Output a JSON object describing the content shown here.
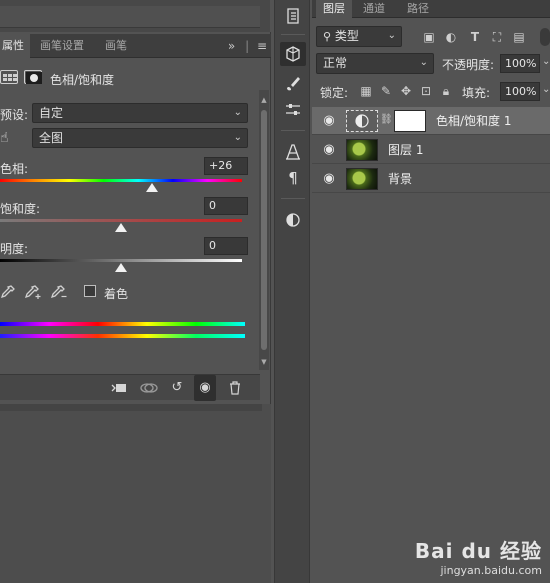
{
  "properties_panel": {
    "tabs": [
      {
        "label": "属性",
        "active": true
      },
      {
        "label": "画笔设置",
        "active": false
      },
      {
        "label": "画笔",
        "active": false
      }
    ],
    "menu_icon": "»",
    "adjustment_title": "色相/饱和度",
    "preset_label": "预设:",
    "preset_value": "自定",
    "channel_value": "全图",
    "hue_label": "色相:",
    "hue_value": "+26",
    "saturation_label": "饱和度:",
    "saturation_value": "0",
    "lightness_label": "明度:",
    "lightness_value": "0",
    "colorize_label": "着色"
  },
  "layers_panel": {
    "tabs": [
      {
        "label": "图层",
        "active": true
      },
      {
        "label": "通道",
        "active": false
      },
      {
        "label": "路径",
        "active": false
      }
    ],
    "filter_label": "类型",
    "blend_mode": "正常",
    "opacity_label": "不透明度:",
    "opacity_value": "100%",
    "lock_label": "锁定:",
    "fill_label": "填充:",
    "fill_value": "100%",
    "layers": [
      {
        "name": "色相/饱和度 1",
        "type": "adjustment",
        "selected": true
      },
      {
        "name": "图层 1",
        "type": "image",
        "selected": false
      },
      {
        "name": "背景",
        "type": "image",
        "selected": false
      }
    ]
  },
  "watermark": {
    "brand": "Bai du 经验",
    "url": "jingyan.baidu.com"
  },
  "colors": {
    "panel_bg": "#535353",
    "tab_bg": "#3e3e3e",
    "selected_layer": "#6a6a6a",
    "input_bg": "#393939"
  }
}
